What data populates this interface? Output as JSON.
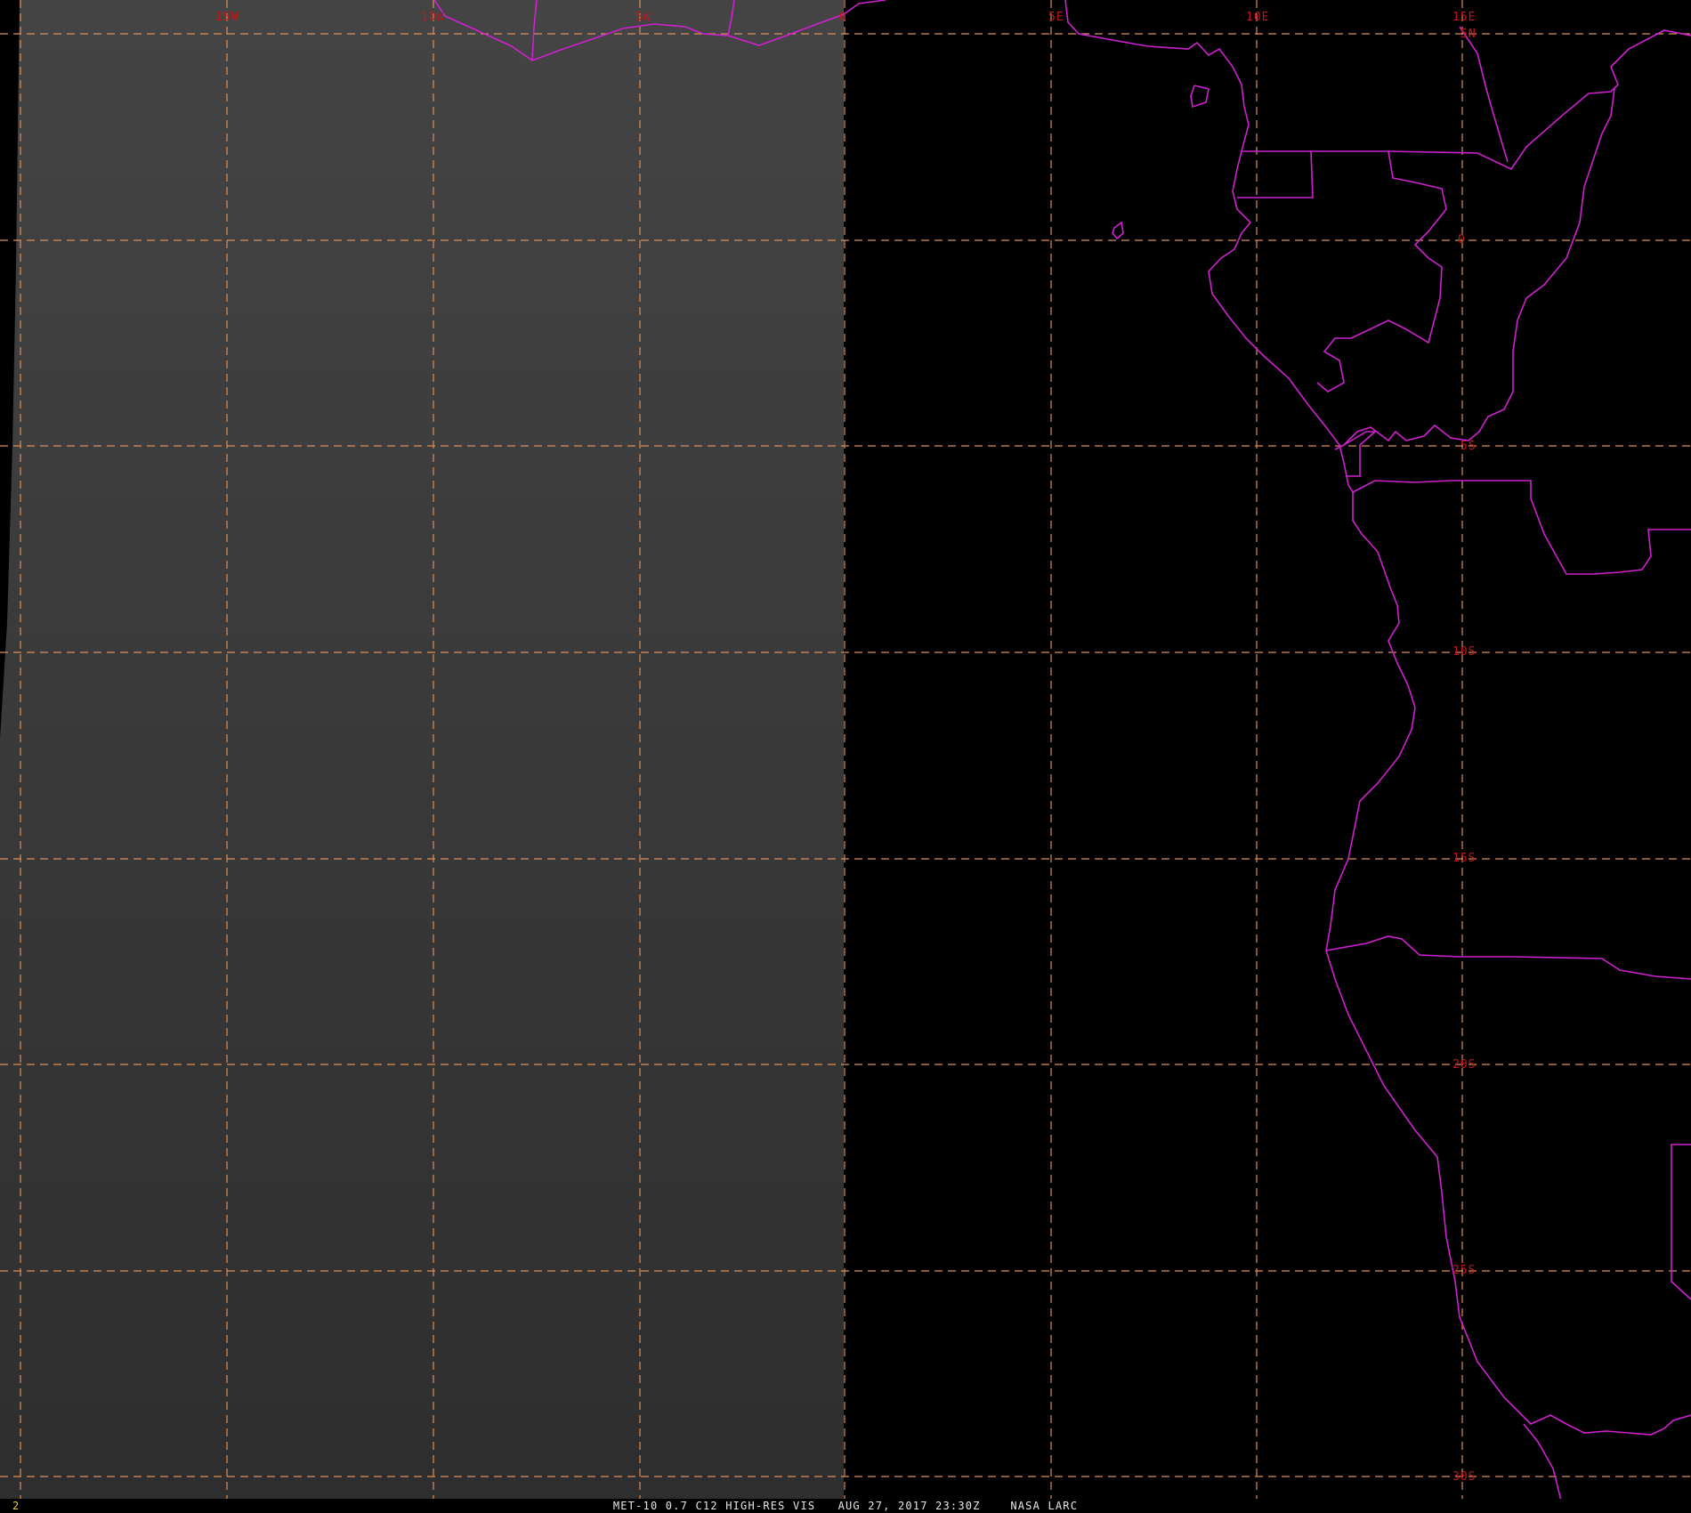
{
  "map": {
    "background_color": "#000000",
    "visible_region_color": "#3a3a3a",
    "graticule_color": "#d9905a",
    "boundary_color": "#d020d0",
    "label_color": "#c4161c",
    "longitude_labels": [
      "15W",
      "10W",
      "5W",
      "0",
      "5E",
      "10E",
      "15E"
    ],
    "latitude_labels": [
      "5N",
      "0",
      "5S",
      "10S",
      "15S",
      "20S",
      "25S",
      "30S"
    ]
  },
  "status": {
    "frame_number": "2",
    "caption": "MET-10 0.7 C12 HIGH-RES VIS   AUG 27, 2017 23:30Z    NASA LARC"
  }
}
